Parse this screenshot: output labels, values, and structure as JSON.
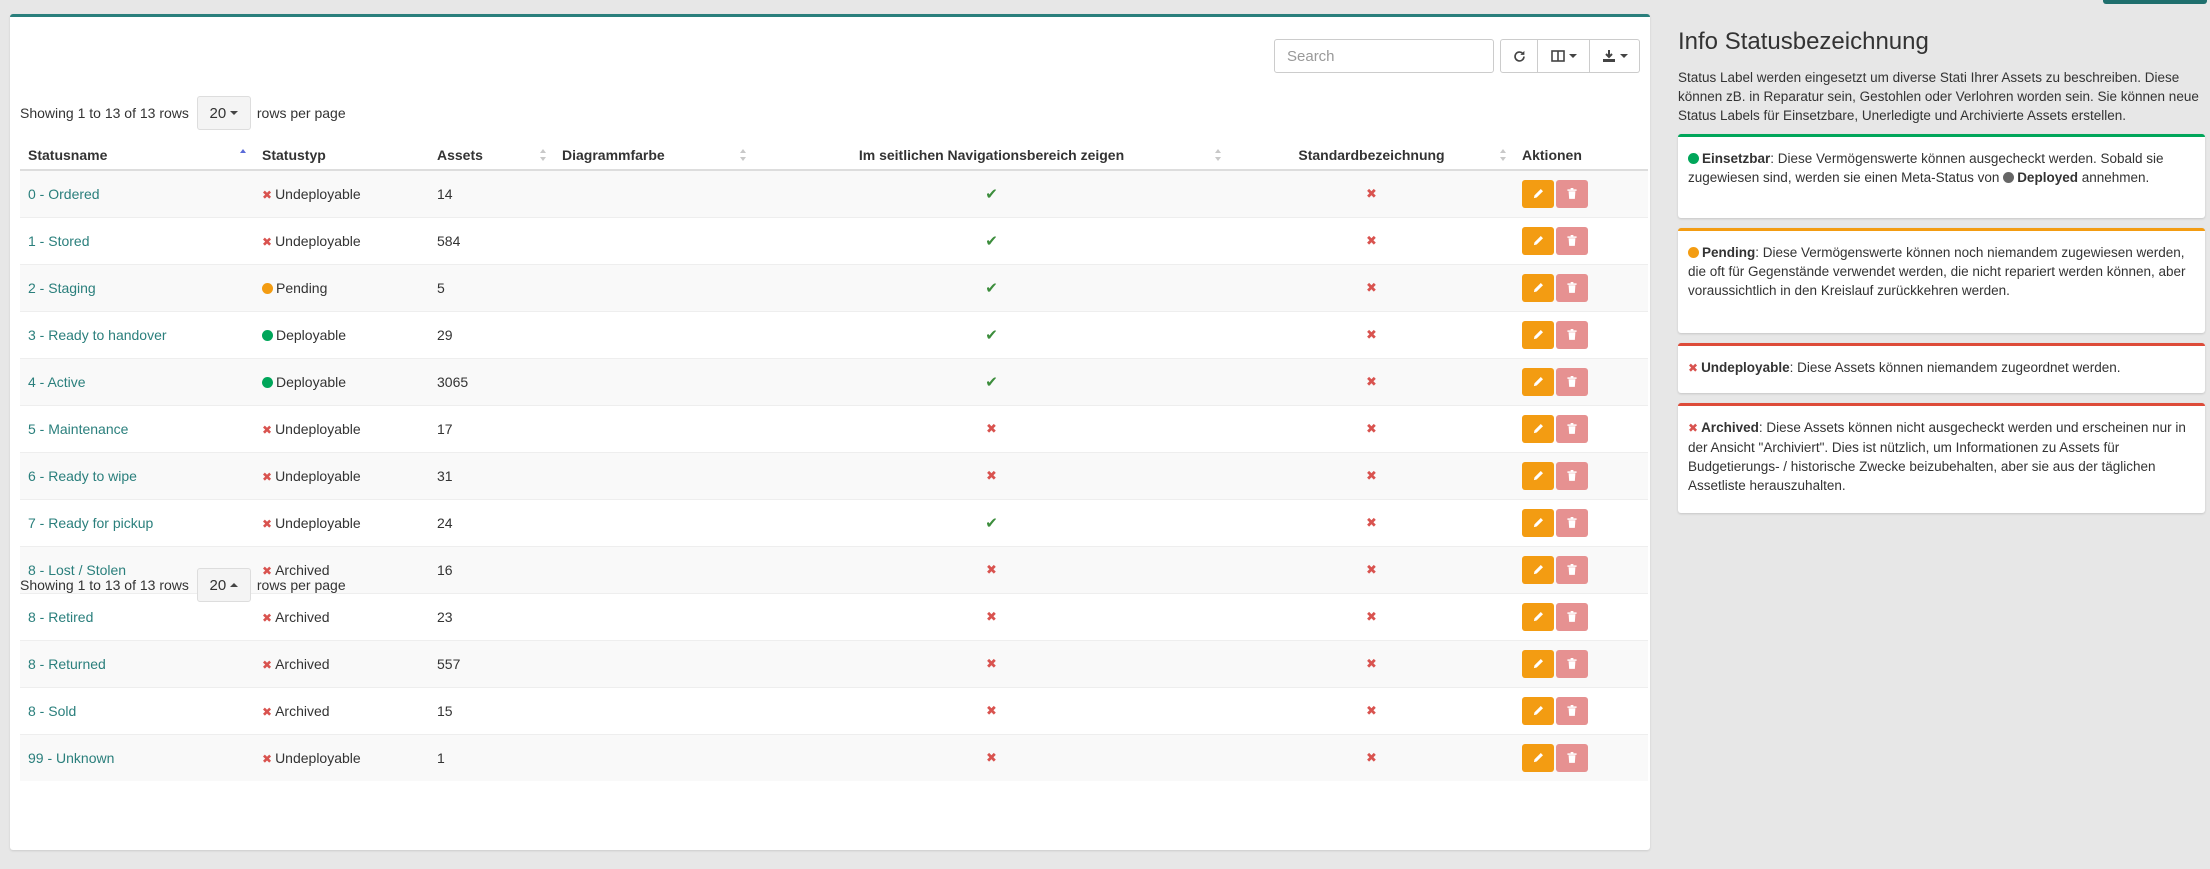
{
  "colors": {
    "accent": "#2a7f7c",
    "deployable": "#00a65a",
    "pending": "#f39c12",
    "undeployable": "#d9534f",
    "edit": "#f39c12",
    "delete": "#e69191",
    "meta_deployed": "#666666"
  },
  "toolbar": {
    "search_placeholder": "Search",
    "refresh_icon": "refresh-icon",
    "columns_icon": "columns-icon",
    "export_icon": "download-icon"
  },
  "pager_top": {
    "showing": "Showing 1 to 13 of 13 rows",
    "rows": "20",
    "rows_label": "rows per page"
  },
  "pager_bottom": {
    "showing": "Showing 1 to 13 of 13 rows",
    "rows": "20",
    "rows_label": "rows per page"
  },
  "table": {
    "headers": [
      "Statusname",
      "Statustyp",
      "Assets",
      "Diagrammfarbe",
      "Im seitlichen Navigationsbereich zeigen",
      "Standardbezeichnung",
      "Aktionen"
    ],
    "rows": [
      {
        "name": "0 - Ordered",
        "type": "Undeployable",
        "type_kind": "x",
        "assets": "14",
        "nav": true,
        "default": false
      },
      {
        "name": "1 - Stored",
        "type": "Undeployable",
        "type_kind": "x",
        "assets": "584",
        "nav": true,
        "default": false
      },
      {
        "name": "2 - Staging",
        "type": "Pending",
        "type_kind": "pending",
        "assets": "5",
        "nav": true,
        "default": false
      },
      {
        "name": "3 - Ready to handover",
        "type": "Deployable",
        "type_kind": "deployable",
        "assets": "29",
        "nav": true,
        "default": false
      },
      {
        "name": "4 - Active",
        "type": "Deployable",
        "type_kind": "deployable",
        "assets": "3065",
        "nav": true,
        "default": false
      },
      {
        "name": "5 - Maintenance",
        "type": "Undeployable",
        "type_kind": "x",
        "assets": "17",
        "nav": false,
        "default": false
      },
      {
        "name": "6 - Ready to wipe",
        "type": "Undeployable",
        "type_kind": "x",
        "assets": "31",
        "nav": false,
        "default": false
      },
      {
        "name": "7 - Ready for pickup",
        "type": "Undeployable",
        "type_kind": "x",
        "assets": "24",
        "nav": true,
        "default": false
      },
      {
        "name": "8 - Lost / Stolen",
        "type": "Archived",
        "type_kind": "x",
        "assets": "16",
        "nav": false,
        "default": false
      },
      {
        "name": "8 - Retired",
        "type": "Archived",
        "type_kind": "x",
        "assets": "23",
        "nav": false,
        "default": false
      },
      {
        "name": "8 - Returned",
        "type": "Archived",
        "type_kind": "x",
        "assets": "557",
        "nav": false,
        "default": false
      },
      {
        "name": "8 - Sold",
        "type": "Archived",
        "type_kind": "x",
        "assets": "15",
        "nav": false,
        "default": false
      },
      {
        "name": "99 - Unknown",
        "type": "Undeployable",
        "type_kind": "x",
        "assets": "1",
        "nav": false,
        "default": false
      }
    ]
  },
  "sidebar": {
    "title": "Info Statusbezeichnung",
    "intro": "Status Label werden eingesetzt um diverse Stati Ihrer Assets zu beschreiben. Diese können zB. in Reparatur sein, Gestohlen oder Verlohren worden sein. Sie können neue Status Labels für Einsetzbare, Unerledigte und Archivierte Assets erstellen.",
    "deployable": {
      "label": "Einsetzbar",
      "text_a": ": Diese Vermögenswerte können ausgecheckt werden. Sobald sie zugewiesen sind, werden sie einen Meta-Status von ",
      "meta": "Deployed",
      "text_b": " annehmen."
    },
    "pending": {
      "label": "Pending",
      "text": ": Diese Vermögenswerte können noch niemandem zugewiesen werden, die oft für Gegenstände verwendet werden, die nicht repariert werden können, aber voraussichtlich in den Kreislauf zurückkehren werden."
    },
    "undeployable": {
      "label": "Undeployable",
      "text": ": Diese Assets können niemandem zugeordnet werden."
    },
    "archived": {
      "label": "Archived",
      "text": ": Diese Assets können nicht ausgecheckt werden und erscheinen nur in der Ansicht \"Archiviert\". Dies ist nützlich, um Informationen zu Assets für Budgetierungs- / historische Zwecke beizubehalten, aber sie aus der täglichen Assetliste herauszuhalten."
    }
  }
}
